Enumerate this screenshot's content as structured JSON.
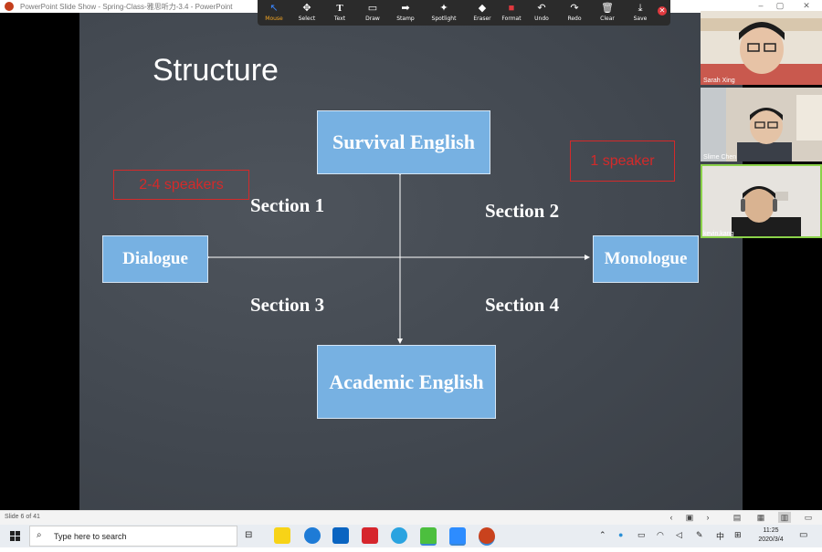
{
  "window": {
    "title": "PowerPoint Slide Show  -  Spring-Class-雅思听力-3.4 - PowerPoint"
  },
  "zoom_toolbar": {
    "tools": [
      {
        "label": "Mouse",
        "icon": "cursor-icon",
        "glyph": "↖",
        "active": true
      },
      {
        "label": "Select",
        "icon": "move-icon",
        "glyph": "✥"
      },
      {
        "label": "Text",
        "icon": "text-icon",
        "glyph": "T"
      },
      {
        "label": "Draw",
        "icon": "draw-icon",
        "glyph": "▭"
      },
      {
        "label": "Stamp",
        "icon": "stamp-icon",
        "glyph": "➡"
      },
      {
        "label": "Spotlight",
        "icon": "spotlight-icon",
        "glyph": "✦"
      },
      {
        "label": "Eraser",
        "icon": "eraser-icon",
        "glyph": "◆"
      },
      {
        "label": "Format",
        "icon": "format-icon",
        "glyph": "■"
      },
      {
        "label": "Undo",
        "icon": "undo-icon",
        "glyph": "↶"
      },
      {
        "label": "Redo",
        "icon": "redo-icon",
        "glyph": "↷"
      },
      {
        "label": "Clear",
        "icon": "trash-icon",
        "glyph": "🗑"
      },
      {
        "label": "Save",
        "icon": "save-icon",
        "glyph": "⤓"
      }
    ],
    "close_glyph": "✕"
  },
  "slide": {
    "title": "Structure",
    "boxes": {
      "top": "Survival English",
      "bottom": "Academic English",
      "left": "Dialogue",
      "right": "Monologue"
    },
    "sections": [
      "Section 1",
      "Section 2",
      "Section 3",
      "Section 4"
    ],
    "annotations": {
      "left": "2-4 speakers",
      "right": "1 speaker"
    }
  },
  "participants": [
    {
      "name": "Sarah Xing"
    },
    {
      "name": "Slime Chen"
    },
    {
      "name": "kevin.kang",
      "speaking": true
    }
  ],
  "statusbar": {
    "slide_indicator": "Slide 6 of 41"
  },
  "taskbar": {
    "search_placeholder": "Type here to search",
    "ime": "中",
    "time": "11:25",
    "date": "2020/3/4"
  },
  "colors": {
    "slide_bg": "#454b53",
    "box_fill": "#77b1e2",
    "annotation_red": "#d42a2a",
    "toolbar_bg": "#2b2b2b",
    "active_tool": "#f5a623",
    "speaking_border": "#8bd24a"
  }
}
